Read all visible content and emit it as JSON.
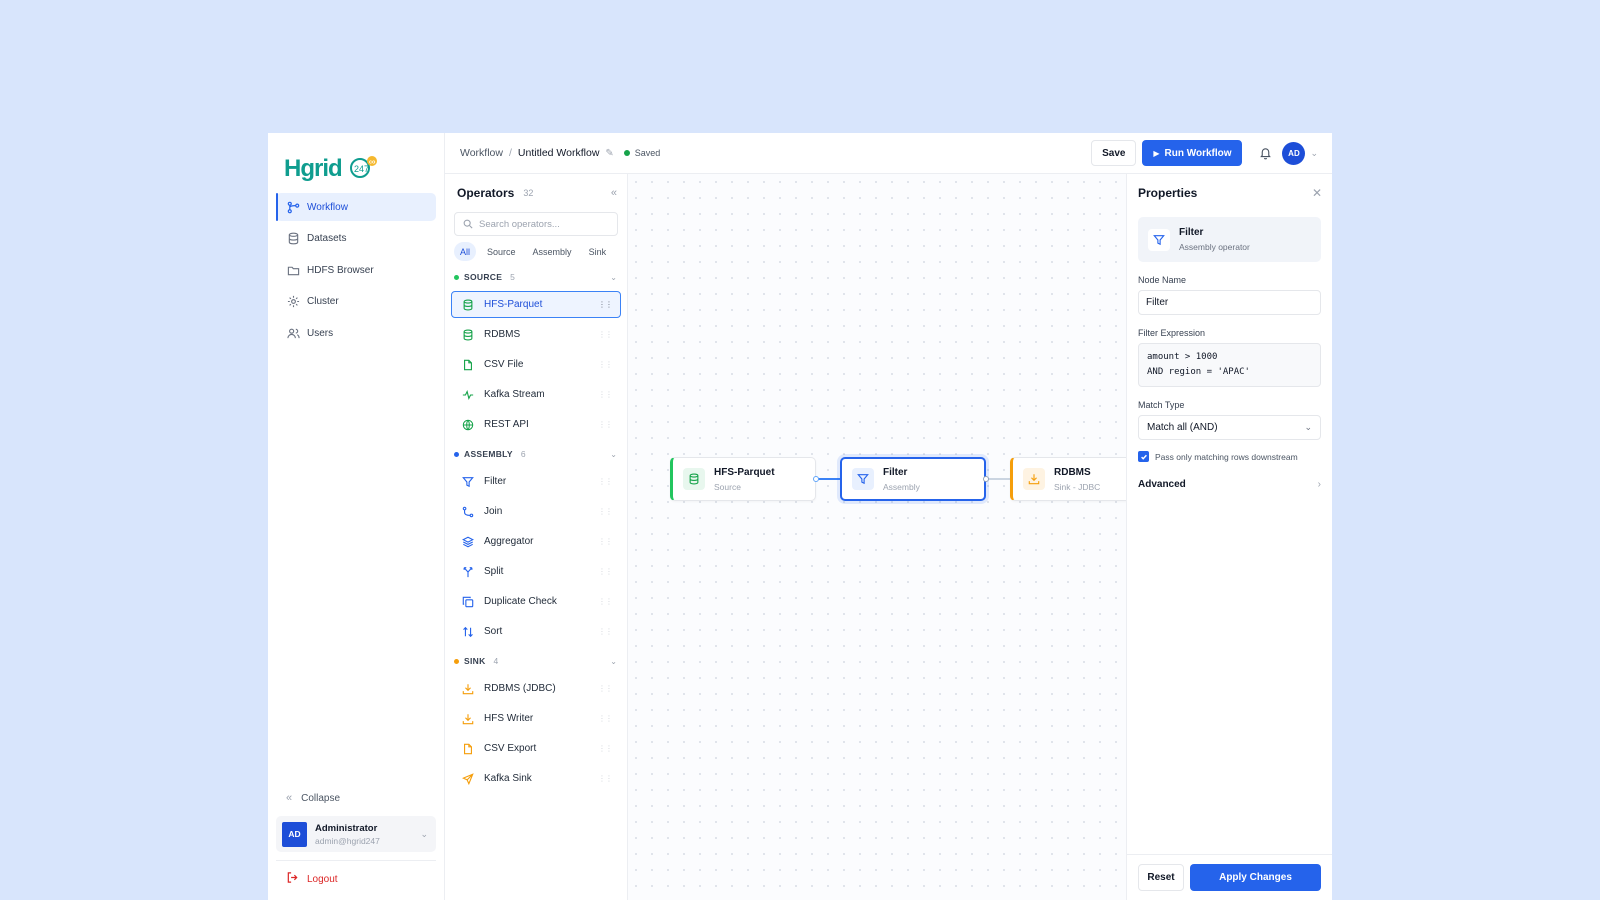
{
  "brand": {
    "name": "Hgrid",
    "badge": "247"
  },
  "sidebar": {
    "items": [
      {
        "label": "Workflow",
        "icon": "workflow-icon",
        "active": true
      },
      {
        "label": "Datasets",
        "icon": "database-icon"
      },
      {
        "label": "HDFS Browser",
        "icon": "folder-icon"
      },
      {
        "label": "Cluster",
        "icon": "cluster-icon"
      },
      {
        "label": "Users",
        "icon": "users-icon"
      }
    ],
    "collapse_label": "Collapse",
    "user": {
      "initials": "AD",
      "name": "Administrator",
      "email": "admin@hgrid247"
    },
    "logout_label": "Logout"
  },
  "topbar": {
    "breadcrumb_root": "Workflow",
    "breadcrumb_sep": "/",
    "breadcrumb_current": "Untitled Workflow",
    "status": "Saved",
    "save_label": "Save",
    "run_label": "Run Workflow",
    "avatar_initials": "AD"
  },
  "operators": {
    "title": "Operators",
    "count": "32",
    "search_placeholder": "Search operators...",
    "filters": [
      "All",
      "Source",
      "Assembly",
      "Sink"
    ],
    "active_filter": "All",
    "groups": [
      {
        "name": "SOURCE",
        "count": "5",
        "color": "#22c55e",
        "items": [
          "HFS-Parquet",
          "RDBMS",
          "CSV File",
          "Kafka Stream",
          "REST API"
        ]
      },
      {
        "name": "ASSEMBLY",
        "count": "6",
        "color": "#2563eb",
        "items": [
          "Filter",
          "Join",
          "Aggregator",
          "Split",
          "Duplicate Check",
          "Sort"
        ]
      },
      {
        "name": "SINK",
        "count": "4",
        "color": "#f59e0b",
        "items": [
          "RDBMS (JDBC)",
          "HFS Writer",
          "CSV Export",
          "Kafka Sink"
        ]
      }
    ],
    "selected_item": "HFS-Parquet"
  },
  "canvas": {
    "nodes": [
      {
        "title": "HFS-Parquet",
        "subtitle": "Source",
        "kind": "source"
      },
      {
        "title": "Filter",
        "subtitle": "Assembly",
        "kind": "assembly",
        "selected": true
      },
      {
        "title": "RDBMS",
        "subtitle": "Sink - JDBC",
        "kind": "sink"
      }
    ]
  },
  "properties": {
    "title": "Properties",
    "operator_name": "Filter",
    "operator_type": "Assembly operator",
    "node_name_label": "Node Name",
    "node_name_value": "Filter",
    "filter_expr_label": "Filter Expression",
    "filter_expr_value": "amount > 1000\nAND region = 'APAC'",
    "match_type_label": "Match Type",
    "match_type_value": "Match all (AND)",
    "checkbox_label": "Pass only matching rows downstream",
    "checkbox_checked": true,
    "advanced_label": "Advanced",
    "reset_label": "Reset",
    "apply_label": "Apply Changes"
  },
  "colors": {
    "accent": "#2563eb",
    "source": "#22c55e",
    "sink": "#f59e0b",
    "danger": "#dc2626",
    "background": "#d8e5fc"
  }
}
